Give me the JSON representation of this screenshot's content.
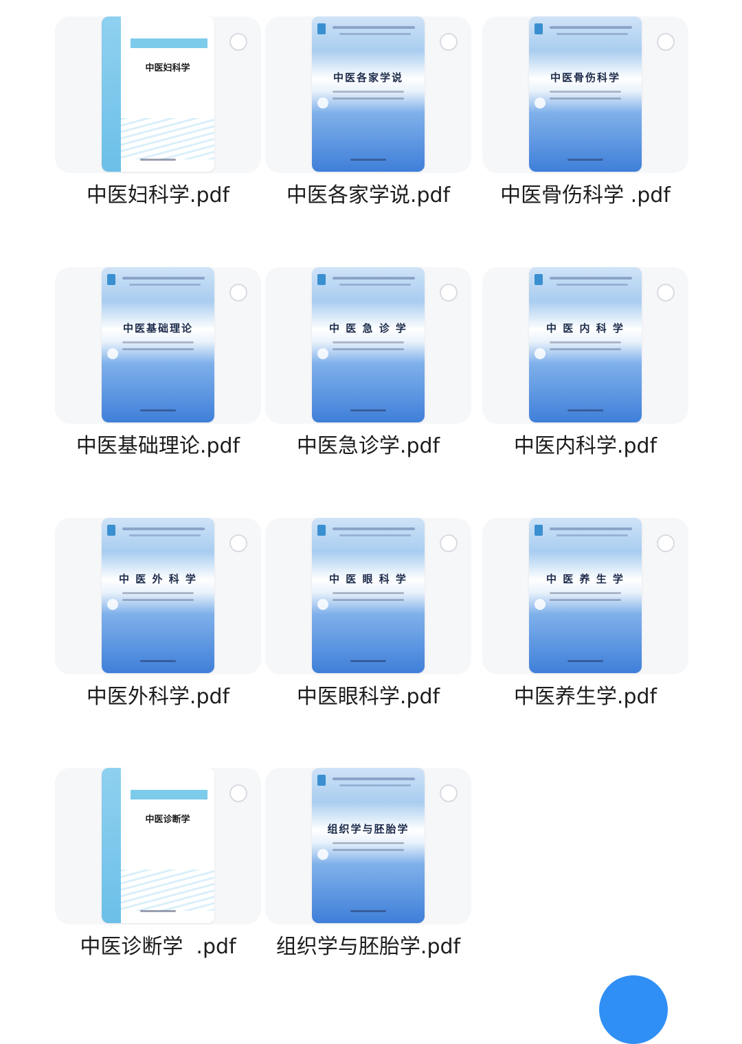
{
  "files": [
    {
      "name": "中医妇科学.pdf",
      "cover_title": "中医妇科学",
      "cover_style": "white"
    },
    {
      "name": "中医各家学说.pdf",
      "cover_title": "中医各家学说",
      "cover_style": "blue"
    },
    {
      "name": "中医骨伤科学 .pdf",
      "cover_title": "中医骨伤科学",
      "cover_style": "blue"
    },
    {
      "name": "中医基础理论.pdf",
      "cover_title": "中医基础理论",
      "cover_style": "blue"
    },
    {
      "name": "中医急诊学.pdf",
      "cover_title": "中 医 急 诊 学",
      "cover_style": "blue"
    },
    {
      "name": "中医内科学.pdf",
      "cover_title": "中 医 内 科 学",
      "cover_style": "blue"
    },
    {
      "name": "中医外科学.pdf",
      "cover_title": "中 医 外 科 学",
      "cover_style": "blue"
    },
    {
      "name": "中医眼科学.pdf",
      "cover_title": "中 医 眼 科 学",
      "cover_style": "blue"
    },
    {
      "name": "中医养生学.pdf",
      "cover_title": "中 医 养 生 学",
      "cover_style": "blue"
    },
    {
      "name": "中医诊断学  .pdf",
      "cover_title": "中医诊断学",
      "cover_style": "white"
    },
    {
      "name": "组织学与胚胎学.pdf",
      "cover_title": "组织学与胚胎学",
      "cover_style": "blue"
    }
  ],
  "colors": {
    "accent": "#2f8ff5",
    "tile_bg": "#f6f7f9"
  }
}
